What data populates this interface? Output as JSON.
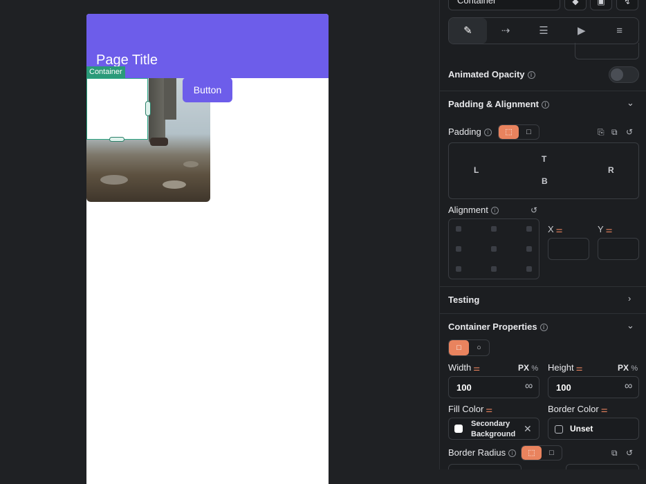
{
  "canvas": {
    "app_bar_title": "Page Title",
    "selection_tag": "Container",
    "preview_button_label": "Button"
  },
  "panel": {
    "widget_name": "Container",
    "animated_opacity": {
      "label": "Animated Opacity",
      "enabled": false
    },
    "padding_alignment": {
      "title": "Padding & Alignment"
    },
    "padding": {
      "label": "Padding",
      "top": "T",
      "bottom": "B",
      "left": "L",
      "right": "R"
    },
    "alignment": {
      "label": "Alignment",
      "x_label": "X",
      "y_label": "Y",
      "x_value": "",
      "y_value": ""
    },
    "testing": {
      "title": "Testing"
    },
    "container_properties": {
      "title": "Container Properties",
      "width": {
        "label": "Width",
        "value": "100",
        "unit": "PX",
        "alt_unit": "%"
      },
      "height": {
        "label": "Height",
        "value": "100",
        "unit": "PX",
        "alt_unit": "%"
      },
      "fill_color": {
        "label": "Fill Color",
        "value_line1": "Secondary",
        "value_line2": "Background"
      },
      "border_color": {
        "label": "Border Color",
        "value": "Unset"
      },
      "border_radius": {
        "label": "Border Radius"
      }
    }
  },
  "colors": {
    "accent": "#e9835e",
    "app_bar": "#6d5dea",
    "selection": "#2aa683"
  }
}
